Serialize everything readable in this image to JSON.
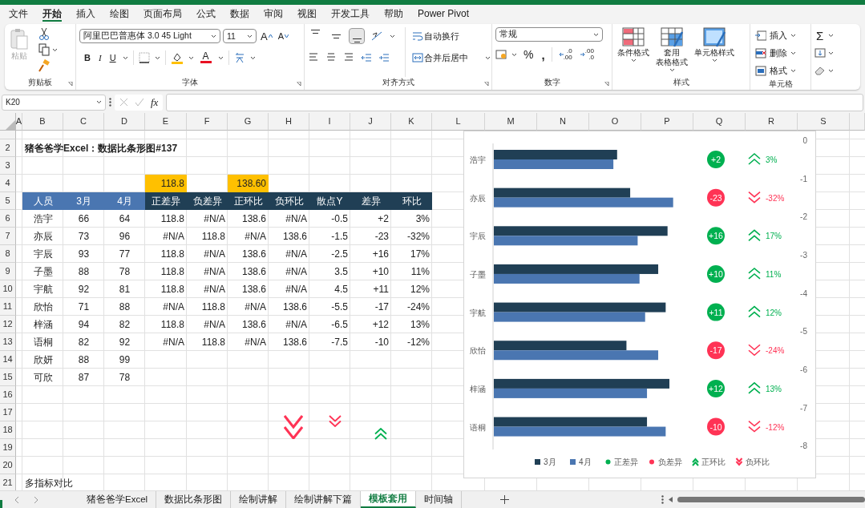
{
  "menu_tabs": [
    {
      "label": "文件",
      "selected": false
    },
    {
      "label": "开始",
      "selected": true
    },
    {
      "label": "插入",
      "selected": false
    },
    {
      "label": "绘图",
      "selected": false
    },
    {
      "label": "页面布局",
      "selected": false
    },
    {
      "label": "公式",
      "selected": false
    },
    {
      "label": "数据",
      "selected": false
    },
    {
      "label": "审阅",
      "selected": false
    },
    {
      "label": "视图",
      "selected": false
    },
    {
      "label": "开发工具",
      "selected": false
    },
    {
      "label": "帮助",
      "selected": false
    },
    {
      "label": "Power Pivot",
      "selected": false
    }
  ],
  "ribbon": {
    "clipboard": {
      "paste": "粘贴",
      "paste_disabled": true,
      "label": "剪贴板"
    },
    "font": {
      "font_name": "阿里巴巴普惠体 3.0 45 Light",
      "font_size": "11",
      "grow": "A",
      "shrink": "A",
      "bold": "B",
      "italic": "I",
      "underline": "U",
      "font_color": "A",
      "label": "字体"
    },
    "alignment": {
      "vertical": [
        {
          "selected": false
        },
        {
          "selected": false
        },
        {
          "selected": true
        }
      ],
      "wrap": "自动换行",
      "merge": "合并后居中",
      "label": "对齐方式"
    },
    "number": {
      "format": "常规",
      "percent": "%",
      "comma": ",",
      "decimals": [
        {
          "top": ".0",
          "bottom": ".00"
        },
        {
          "top": ".00",
          "bottom": ".0"
        }
      ],
      "label": "数字"
    },
    "styles": {
      "buttons": [
        {
          "lines": [
            "条件格式"
          ],
          "kind": "conditional"
        },
        {
          "lines": [
            "套用",
            "表格格式"
          ],
          "kind": "table"
        },
        {
          "lines": [
            "单元格样式"
          ],
          "kind": "cell"
        }
      ],
      "label": "样式"
    },
    "cells": {
      "buttons": [
        {
          "label": "插入",
          "kind": "insert"
        },
        {
          "label": "删除",
          "kind": "delete"
        },
        {
          "label": "格式",
          "kind": "format"
        }
      ],
      "label": "单元格"
    },
    "editing": {
      "sum": "Σ"
    }
  },
  "formula_bar": {
    "name_box": "K20",
    "fx": "fx"
  },
  "sheet": {
    "columns": [
      "A",
      "B",
      "C",
      "D",
      "E",
      "F",
      "G",
      "H",
      "I",
      "J",
      "K",
      "L",
      "M",
      "N",
      "O",
      "P",
      "Q",
      "R",
      "S"
    ],
    "rows": [
      {
        "number": "2",
        "kind": "title",
        "cells": [
          "猪爸爸学Excel：数据比条形图#137"
        ]
      },
      {
        "number": "3",
        "kind": "blank"
      },
      {
        "number": "4",
        "kind": "marker",
        "cells": [
          null,
          null,
          null,
          "118.8",
          null,
          "138.60"
        ]
      },
      {
        "number": "5",
        "kind": "header",
        "cells": [
          "人员",
          "3月",
          "4月",
          "正差异",
          "负差异",
          "正环比",
          "负环比",
          "散点Y",
          "差异",
          "环比"
        ]
      },
      {
        "number": "6",
        "kind": "data",
        "cells": [
          "浩宇",
          "66",
          "64",
          "118.8",
          "#N/A",
          "138.6",
          "#N/A",
          "-0.5",
          "+2",
          "3%"
        ]
      },
      {
        "number": "7",
        "kind": "data",
        "cells": [
          "亦辰",
          "73",
          "96",
          "#N/A",
          "118.8",
          "#N/A",
          "138.6",
          "-1.5",
          "-23",
          "-32%"
        ]
      },
      {
        "number": "8",
        "kind": "data",
        "cells": [
          "宇辰",
          "93",
          "77",
          "118.8",
          "#N/A",
          "138.6",
          "#N/A",
          "-2.5",
          "+16",
          "17%"
        ]
      },
      {
        "number": "9",
        "kind": "data",
        "cells": [
          "子墨",
          "88",
          "78",
          "118.8",
          "#N/A",
          "138.6",
          "#N/A",
          "3.5",
          "+10",
          "11%"
        ]
      },
      {
        "number": "10",
        "kind": "data",
        "cells": [
          "宇航",
          "92",
          "81",
          "118.8",
          "#N/A",
          "138.6",
          "#N/A",
          "4.5",
          "+11",
          "12%"
        ]
      },
      {
        "number": "11",
        "kind": "data",
        "cells": [
          "欣怡",
          "71",
          "88",
          "#N/A",
          "118.8",
          "#N/A",
          "138.6",
          "-5.5",
          "-17",
          "-24%"
        ]
      },
      {
        "number": "12",
        "kind": "data",
        "cells": [
          "梓涵",
          "94",
          "82",
          "118.8",
          "#N/A",
          "138.6",
          "#N/A",
          "-6.5",
          "+12",
          "13%"
        ]
      },
      {
        "number": "13",
        "kind": "data",
        "cells": [
          "语桐",
          "82",
          "92",
          "#N/A",
          "118.8",
          "#N/A",
          "138.6",
          "-7.5",
          "-10",
          "-12%"
        ]
      },
      {
        "number": "14",
        "kind": "data",
        "cells": [
          "欣妍",
          "88",
          "99"
        ]
      },
      {
        "number": "15",
        "kind": "data",
        "cells": [
          "可欣",
          "87",
          "78"
        ]
      },
      {
        "number": "16",
        "kind": "blank"
      },
      {
        "number": "17",
        "kind": "blank"
      },
      {
        "number": "18",
        "kind": "blank"
      },
      {
        "number": "19",
        "kind": "blank"
      },
      {
        "number": "20",
        "kind": "blank"
      },
      {
        "number": "21",
        "kind": "note",
        "cells": [
          "多指标对比"
        ]
      }
    ],
    "shapes": [
      {
        "kind": "down"
      },
      {
        "kind": "down"
      },
      {
        "kind": "up"
      }
    ]
  },
  "chart": {
    "categories": [
      "浩宇",
      "亦辰",
      "宇辰",
      "子墨",
      "宇航",
      "欣怡",
      "梓涵",
      "语桐"
    ],
    "series": [
      {
        "name": "3月",
        "color": "#203f55"
      },
      {
        "name": "4月",
        "color": "#4a76b1"
      }
    ],
    "markers": [
      {
        "difference": "+2",
        "ratio": "3%",
        "kind": "up"
      },
      {
        "difference": "-23",
        "ratio": "-32%",
        "kind": "down"
      },
      {
        "difference": "+16",
        "ratio": "17%",
        "kind": "up"
      },
      {
        "difference": "+10",
        "ratio": "11%",
        "kind": "up"
      },
      {
        "difference": "+11",
        "ratio": "12%",
        "kind": "up"
      },
      {
        "difference": "-17",
        "ratio": "-24%",
        "kind": "down"
      },
      {
        "difference": "+12",
        "ratio": "13%",
        "kind": "up"
      },
      {
        "difference": "-10",
        "ratio": "-12%",
        "kind": "down"
      }
    ],
    "axis_labels": [
      "0",
      "-1",
      "-2",
      "-3",
      "-4",
      "-5",
      "-6",
      "-7",
      "-8"
    ],
    "marker_legend": [
      {
        "label": "正差异",
        "kind": "dot",
        "color": "#00b050"
      },
      {
        "label": "负差异",
        "kind": "dot",
        "color": "#ff3355"
      },
      {
        "label": "正环比",
        "kind": "up",
        "color": "#00b050"
      },
      {
        "label": "负环比",
        "kind": "down",
        "color": "#ff3355"
      }
    ]
  },
  "sheet_tabs": [
    {
      "label": "猪爸爸学Excel",
      "selected": false
    },
    {
      "label": "数据比条形图",
      "selected": false
    },
    {
      "label": "绘制讲解",
      "selected": false
    },
    {
      "label": "绘制讲解下篇",
      "selected": false
    },
    {
      "label": "模板套用",
      "selected": true
    },
    {
      "label": "时间轴",
      "selected": false
    }
  ]
}
